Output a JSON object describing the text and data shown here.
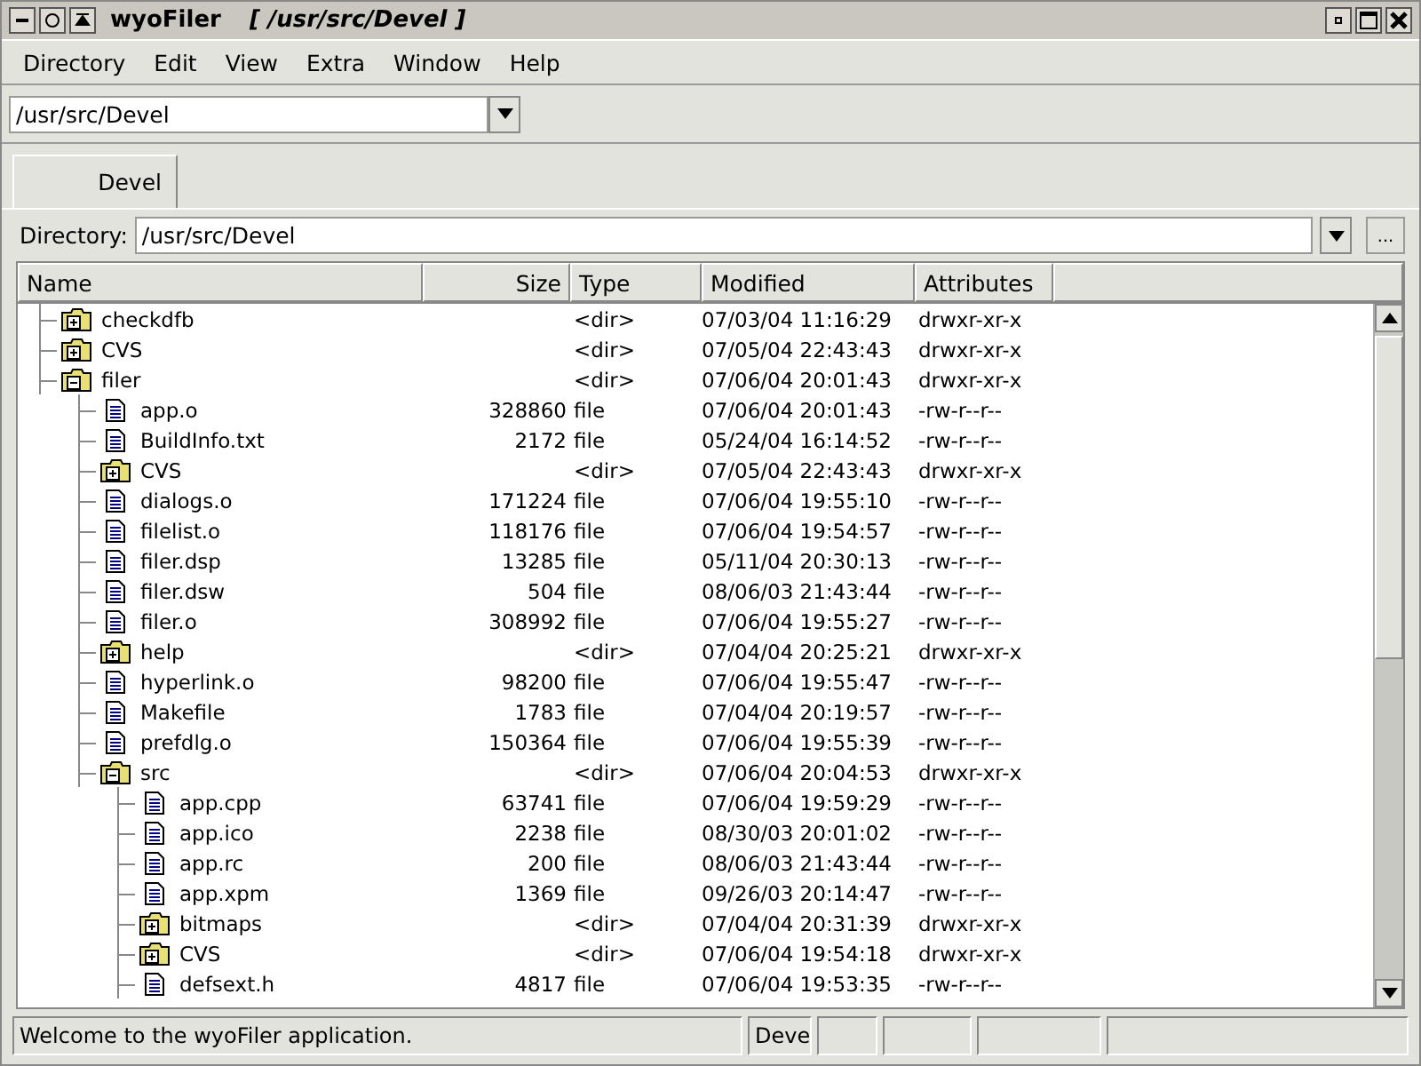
{
  "window": {
    "app": "wyoFiler",
    "title": "[ /usr/src/Devel ]"
  },
  "menu": [
    "Directory",
    "Edit",
    "View",
    "Extra",
    "Window",
    "Help"
  ],
  "path_combo": {
    "value": "/usr/src/Devel"
  },
  "tabs": [
    {
      "label": "Devel",
      "selected": true
    }
  ],
  "directory": {
    "label": "Directory:",
    "value": "/usr/src/Devel",
    "browse": "..."
  },
  "table": {
    "columns": [
      "Name",
      "Size",
      "Type",
      "Modified",
      "Attributes"
    ],
    "rows": [
      {
        "kind": "dir",
        "name": "checkdfb",
        "type": "<dir>",
        "modified": "07/03/04 11:16:29",
        "attributes": "drwxr-xr-x",
        "expanded": false
      },
      {
        "kind": "dir",
        "name": "CVS",
        "type": "<dir>",
        "modified": "07/05/04 22:43:43",
        "attributes": "drwxr-xr-x",
        "expanded": false
      },
      {
        "kind": "dir",
        "name": "filer",
        "type": "<dir>",
        "modified": "07/06/04 20:01:43",
        "attributes": "drwxr-xr-x",
        "expanded": true,
        "children": [
          {
            "kind": "file",
            "name": "app.o",
            "size": "328860",
            "type": "file",
            "modified": "07/06/04 20:01:43",
            "attributes": "-rw-r--r--"
          },
          {
            "kind": "file",
            "name": "BuildInfo.txt",
            "size": "2172",
            "type": "file",
            "modified": "05/24/04 16:14:52",
            "attributes": "-rw-r--r--"
          },
          {
            "kind": "dir",
            "name": "CVS",
            "type": "<dir>",
            "modified": "07/05/04 22:43:43",
            "attributes": "drwxr-xr-x",
            "expanded": false
          },
          {
            "kind": "file",
            "name": "dialogs.o",
            "size": "171224",
            "type": "file",
            "modified": "07/06/04 19:55:10",
            "attributes": "-rw-r--r--"
          },
          {
            "kind": "file",
            "name": "filelist.o",
            "size": "118176",
            "type": "file",
            "modified": "07/06/04 19:54:57",
            "attributes": "-rw-r--r--"
          },
          {
            "kind": "file",
            "name": "filer.dsp",
            "size": "13285",
            "type": "file",
            "modified": "05/11/04 20:30:13",
            "attributes": "-rw-r--r--"
          },
          {
            "kind": "file",
            "name": "filer.dsw",
            "size": "504",
            "type": "file",
            "modified": "08/06/03 21:43:44",
            "attributes": "-rw-r--r--"
          },
          {
            "kind": "file",
            "name": "filer.o",
            "size": "308992",
            "type": "file",
            "modified": "07/06/04 19:55:27",
            "attributes": "-rw-r--r--"
          },
          {
            "kind": "dir",
            "name": "help",
            "type": "<dir>",
            "modified": "07/04/04 20:25:21",
            "attributes": "drwxr-xr-x",
            "expanded": false
          },
          {
            "kind": "file",
            "name": "hyperlink.o",
            "size": "98200",
            "type": "file",
            "modified": "07/06/04 19:55:47",
            "attributes": "-rw-r--r--"
          },
          {
            "kind": "file",
            "name": "Makefile",
            "size": "1783",
            "type": "file",
            "modified": "07/04/04 20:19:57",
            "attributes": "-rw-r--r--"
          },
          {
            "kind": "file",
            "name": "prefdlg.o",
            "size": "150364",
            "type": "file",
            "modified": "07/06/04 19:55:39",
            "attributes": "-rw-r--r--"
          },
          {
            "kind": "dir",
            "name": "src",
            "type": "<dir>",
            "modified": "07/06/04 20:04:53",
            "attributes": "drwxr-xr-x",
            "expanded": true,
            "children": [
              {
                "kind": "file",
                "name": "app.cpp",
                "size": "63741",
                "type": "file",
                "modified": "07/06/04 19:59:29",
                "attributes": "-rw-r--r--"
              },
              {
                "kind": "file",
                "name": "app.ico",
                "size": "2238",
                "type": "file",
                "modified": "08/30/03 20:01:02",
                "attributes": "-rw-r--r--"
              },
              {
                "kind": "file",
                "name": "app.rc",
                "size": "200",
                "type": "file",
                "modified": "08/06/03 21:43:44",
                "attributes": "-rw-r--r--"
              },
              {
                "kind": "file",
                "name": "app.xpm",
                "size": "1369",
                "type": "file",
                "modified": "09/26/03 20:14:47",
                "attributes": "-rw-r--r--"
              },
              {
                "kind": "dir",
                "name": "bitmaps",
                "type": "<dir>",
                "modified": "07/04/04 20:31:39",
                "attributes": "drwxr-xr-x",
                "expanded": false
              },
              {
                "kind": "dir",
                "name": "CVS",
                "type": "<dir>",
                "modified": "07/06/04 19:54:18",
                "attributes": "drwxr-xr-x",
                "expanded": false
              },
              {
                "kind": "file",
                "name": "defsext.h",
                "size": "4817",
                "type": "file",
                "modified": "07/06/04 19:53:35",
                "attributes": "-rw-r--r--"
              }
            ]
          }
        ]
      }
    ]
  },
  "status_bar": {
    "message": "Welcome to the wyoFiler application.",
    "panel": "Deve"
  }
}
